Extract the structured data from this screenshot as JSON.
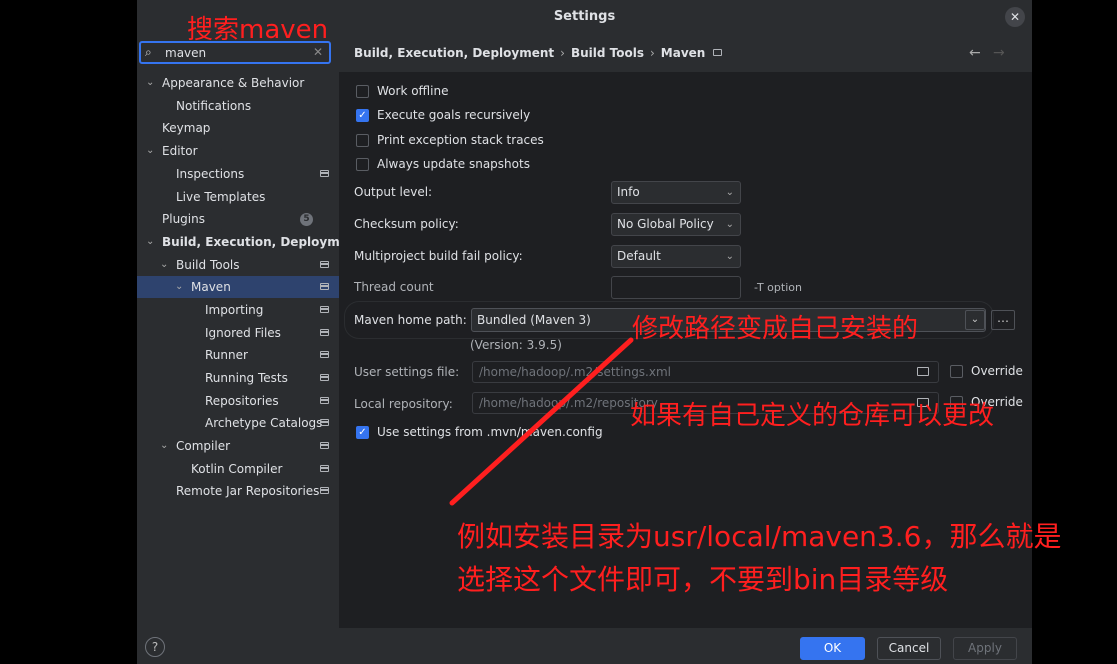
{
  "window": {
    "title": "Settings"
  },
  "search": {
    "query": "maven"
  },
  "sidebar": {
    "items": [
      {
        "label": "Appearance & Behavior",
        "chevron": "open"
      },
      {
        "label": "Notifications"
      },
      {
        "label": "Keymap"
      },
      {
        "label": "Editor",
        "chevron": "open"
      },
      {
        "label": "Inspections"
      },
      {
        "label": "Live Templates"
      },
      {
        "label": "Plugins",
        "badge": "5"
      },
      {
        "label": "Build, Execution, Deployment",
        "chevron": "open"
      },
      {
        "label": "Build Tools",
        "chevron": "open"
      },
      {
        "label": "Maven",
        "chevron": "open",
        "selected": true
      },
      {
        "label": "Importing"
      },
      {
        "label": "Ignored Files"
      },
      {
        "label": "Runner"
      },
      {
        "label": "Running Tests"
      },
      {
        "label": "Repositories"
      },
      {
        "label": "Archetype Catalogs"
      },
      {
        "label": "Compiler",
        "chevron": "open"
      },
      {
        "label": "Kotlin Compiler"
      },
      {
        "label": "Remote Jar Repositories"
      }
    ]
  },
  "breadcrumb": {
    "items": [
      "Build, Execution, Deployment",
      "Build Tools",
      "Maven"
    ]
  },
  "options": {
    "work_offline": {
      "label": "Work offline",
      "checked": false
    },
    "execute_goals": {
      "label": "Execute goals recursively",
      "checked": true
    },
    "print_exception": {
      "label": "Print exception stack traces",
      "checked": false
    },
    "always_update": {
      "label": "Always update snapshots",
      "checked": false
    },
    "use_settings": {
      "label": "Use settings from .mvn/maven.config",
      "checked": true
    }
  },
  "fields": {
    "output_level": {
      "label": "Output level:",
      "value": "Info"
    },
    "checksum_policy": {
      "label": "Checksum policy:",
      "value": "No Global Policy"
    },
    "fail_policy": {
      "label": "Multiproject build fail policy:",
      "value": "Default"
    },
    "thread_count": {
      "label": "Thread count",
      "value": "",
      "hint": "-T option"
    },
    "maven_home": {
      "label": "Maven home path:",
      "value": "Bundled (Maven 3)",
      "version": "(Version: 3.9.5)"
    },
    "user_settings": {
      "label": "User settings file:",
      "value": "/home/hadoop/.m2/settings.xml",
      "override": "Override"
    },
    "local_repo": {
      "label": "Local repository:",
      "value": "/home/hadoop/.m2/repository",
      "override": "Override"
    }
  },
  "buttons": {
    "ok": "OK",
    "cancel": "Cancel",
    "apply": "Apply",
    "help": "?"
  },
  "annotations": {
    "search_hint": "搜索maven",
    "path_hint": "修改路径变成自己安装的",
    "repo_hint": "如果有自己定义的仓库可以更改",
    "example_line1": "例如安装目录为usr/local/maven3.6，那么就是",
    "example_line2": "选择这个文件即可，不要到bin目录等级"
  },
  "colors": {
    "accent": "#3574f0",
    "annotation": "#ff1f1f"
  }
}
